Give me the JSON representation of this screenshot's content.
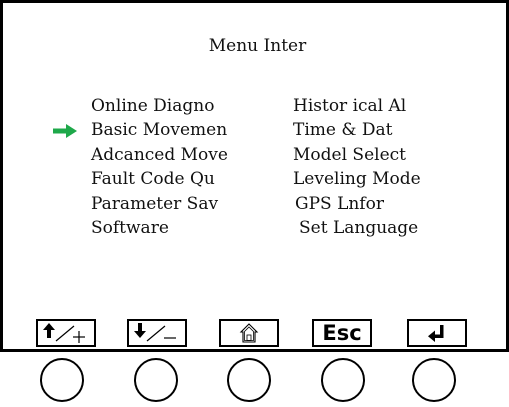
{
  "screen": {
    "title": "Menu Inter"
  },
  "menu": {
    "selected_index": 1,
    "left": [
      {
        "label": "Online Diagno"
      },
      {
        "label": "Basic Movemen"
      },
      {
        "label": "Adcanced Move"
      },
      {
        "label": "Fault Code Qu"
      },
      {
        "label": "Parameter Sav"
      },
      {
        "label": "Software"
      }
    ],
    "right": [
      {
        "label": "Histor ical Al"
      },
      {
        "label": "Time & Dat"
      },
      {
        "label": "Model Select"
      },
      {
        "label": "Leveling Mode"
      },
      {
        "label": "GPS Lnfor"
      },
      {
        "label": "Set Language"
      }
    ]
  },
  "softkeys": {
    "up_plus": {
      "icon": "up-plus-icon"
    },
    "down_minus": {
      "icon": "down-minus-icon"
    },
    "home": {
      "icon": "home-icon"
    },
    "esc": {
      "label": "Esc"
    },
    "enter": {
      "icon": "enter-icon"
    }
  },
  "colors": {
    "cursor_arrow": "#1ea84a",
    "border": "#000000",
    "text": "#111111",
    "background": "#ffffff"
  }
}
